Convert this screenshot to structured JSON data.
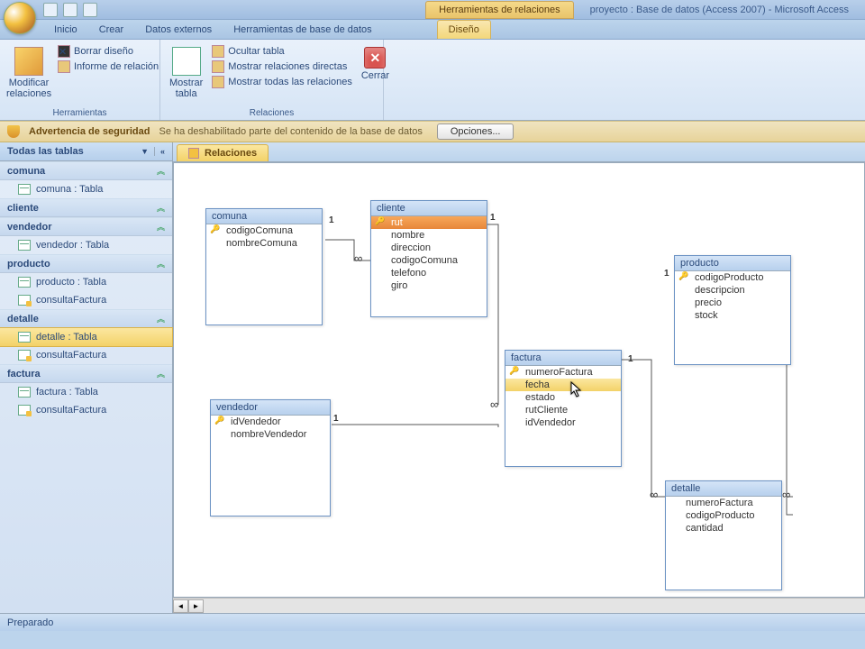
{
  "title": {
    "context_tool_label": "Herramientas de relaciones",
    "window_title": "proyecto : Base de datos (Access 2007) - Microsoft Access"
  },
  "ribbon_tabs": {
    "inicio": "Inicio",
    "crear": "Crear",
    "datos_externos": "Datos externos",
    "herramientas_bd": "Herramientas de base de datos",
    "diseno": "Diseño"
  },
  "ribbon": {
    "group_tools_label": "Herramientas",
    "group_rel_label": "Relaciones",
    "modificar": "Modificar relaciones",
    "borrar": "Borrar diseño",
    "informe": "Informe de relación",
    "mostrar_tabla": "Mostrar tabla",
    "ocultar": "Ocultar tabla",
    "mostrar_directas": "Mostrar relaciones directas",
    "mostrar_todas": "Mostrar todas las relaciones",
    "cerrar": "Cerrar"
  },
  "security": {
    "title": "Advertencia de seguridad",
    "msg": "Se ha deshabilitado parte del contenido de la base de datos",
    "btn": "Opciones..."
  },
  "nav": {
    "header": "Todas las tablas",
    "groups": {
      "comuna": {
        "label": "comuna",
        "items": [
          "comuna : Tabla"
        ]
      },
      "cliente": {
        "label": "cliente",
        "items": []
      },
      "vendedor": {
        "label": "vendedor",
        "items": [
          "vendedor : Tabla"
        ]
      },
      "producto": {
        "label": "producto",
        "items": [
          "producto : Tabla",
          "consultaFactura"
        ]
      },
      "detalle": {
        "label": "detalle",
        "items": [
          "detalle : Tabla",
          "consultaFactura"
        ]
      },
      "factura": {
        "label": "factura",
        "items": [
          "factura : Tabla",
          "consultaFactura"
        ]
      }
    }
  },
  "doctab": "Relaciones",
  "tables": {
    "comuna": {
      "title": "comuna",
      "fields": [
        "codigoComuna",
        "nombreComuna"
      ]
    },
    "cliente": {
      "title": "cliente",
      "fields": [
        "rut",
        "nombre",
        "direccion",
        "codigoComuna",
        "telefono",
        "giro"
      ]
    },
    "producto": {
      "title": "producto",
      "fields": [
        "codigoProducto",
        "descripcion",
        "precio",
        "stock"
      ]
    },
    "factura": {
      "title": "factura",
      "fields": [
        "numeroFactura",
        "fecha",
        "estado",
        "rutCliente",
        "idVendedor"
      ]
    },
    "vendedor": {
      "title": "vendedor",
      "fields": [
        "idVendedor",
        "nombreVendedor"
      ]
    },
    "detalle": {
      "title": "detalle",
      "fields": [
        "numeroFactura",
        "codigoProducto",
        "cantidad"
      ]
    }
  },
  "status": "Preparado"
}
